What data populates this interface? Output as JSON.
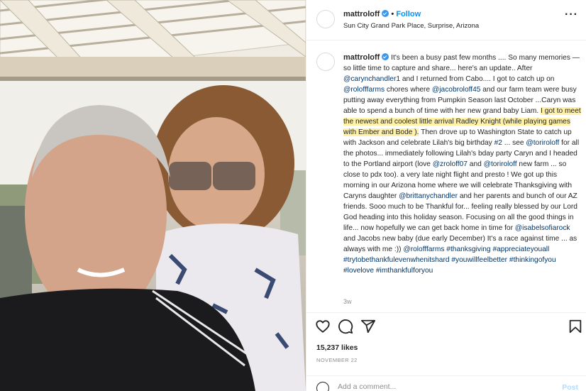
{
  "post": {
    "username": "mattroloff",
    "verified": true,
    "separator": "•",
    "follow_label": "Follow",
    "location": "Sun City Grand Park Place, Surprise, Arizona",
    "more_icon": "more-horizontal-icon",
    "more_glyph": "···"
  },
  "caption": {
    "username": "mattroloff",
    "segments": {
      "s1": " It's been a busy past few months .... So many memories — so little time to capture and share... here's an update.. After ",
      "l1": "@carynchandler1",
      "s2": " and I returned from Cabo.... I got to catch up on ",
      "l2": "@rolofffarms",
      "s3": " chores where ",
      "l3": "@jacobroloff45",
      "s4": " and our farm team were busy putting away everything from Pumpkin Season last October ...Caryn was able to spend a bunch of time with her new grand baby Liam. ",
      "hl": "I got to meet the newest and coolest little arrival Radley Knight (while playing games with Ember and Bode ).",
      "s5": " Then drove up to Washington State to catch up with Jackson and celebrate Lilah's big birthday ",
      "l4": "#2",
      "s6": " ... see ",
      "l5": "@toriroloff",
      "s7": " for all the photos... immediately following Lilah's bday party Caryn and I headed to the Portland airport (love ",
      "l6": "@zroloff07",
      "s8": " and ",
      "l7": "@toriroloff",
      "s9": " new farm ... so close to pdx too). a very late night flight and presto ! We got up this morning in our Arizona home where we will celebrate Thanksgiving with Caryns daughter ",
      "l8": "@brittanychandler",
      "s10": " and her parents and bunch of our AZ friends. Sooo much to be Thankful for... feeling really blessed by our Lord God heading into this holiday season. Focusing on all the good things in life... now hopefully we can get back home in time for ",
      "l9": "@isabelsofiarock",
      "s11": " and Jacobs new baby (due early December) It's a race against time ... as always with me :)) ",
      "l10": "@rolofffarms",
      "l11": "#thanksgiving",
      "l12": "#appreciateyouall",
      "l13": "#trytobethankfulevenwhenitshard",
      "l14": "#youwillfeelbetter",
      "l15": "#thinkingofyou",
      "l16": "#lovelove",
      "l17": "#imthankfulforyou"
    },
    "time_ago": "3w"
  },
  "actions": {
    "icons": [
      "heart-icon",
      "comment-icon",
      "share-icon",
      "bookmark-icon"
    ],
    "likes": "15,237 likes",
    "date": "NOVEMBER 22",
    "comment_placeholder": "Add a comment...",
    "post_label": "Post",
    "emoji_icon": "emoji-icon"
  },
  "colors": {
    "link": "#00376b",
    "follow": "#0095f6",
    "highlight": "#fff2a8",
    "muted": "#8e8e8e",
    "post_disabled": "#b3dbff"
  }
}
